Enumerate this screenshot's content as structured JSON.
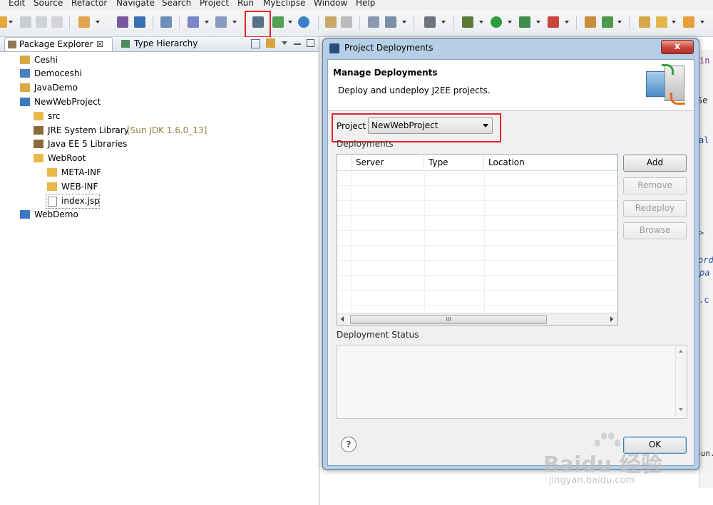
{
  "menu": [
    "Edit",
    "Source",
    "Refactor",
    "Navigate",
    "Search",
    "Project",
    "Run",
    "MyEclipse",
    "Window",
    "Help"
  ],
  "tabs": {
    "package_explorer": "Package Explorer",
    "package_explorer_close": "☒",
    "type_hierarchy": "Type Hierarchy"
  },
  "tree": [
    {
      "label": "Ceshi"
    },
    {
      "label": "Democeshi"
    },
    {
      "label": "JavaDemo"
    },
    {
      "label": "NewWebProject"
    },
    {
      "label": "src"
    },
    {
      "label": "JRE System Library",
      "decoration": "[Sun JDK 1.6.0_13]"
    },
    {
      "label": "Java EE 5 Libraries"
    },
    {
      "label": "WebRoot"
    },
    {
      "label": "META-INF"
    },
    {
      "label": "WEB-INF"
    },
    {
      "label": "index.jsp"
    },
    {
      "label": "WebDemo"
    }
  ],
  "editor_fragments": [
    "in",
    "Se",
    "al",
    ">",
    "ord",
    "pa",
    ".c",
    "sun."
  ],
  "dialog": {
    "title": "Project Deployments",
    "close_label": "x",
    "heading": "Manage Deployments",
    "description": "Deploy and undeploy J2EE projects.",
    "project_label": "Project",
    "project_value": "NewWebProject",
    "deployments_label": "Deployments",
    "columns": [
      "Server",
      "Type",
      "Location"
    ],
    "scroll_mark": "III",
    "buttons": {
      "add": "Add",
      "remove": "Remove",
      "redeploy": "Redeploy",
      "browse": "Browse",
      "ok": "OK"
    },
    "status_label": "Deployment Status",
    "help": "?"
  },
  "watermark": {
    "logo": "Baidu 经验",
    "url": "jingyan.baidu.com"
  },
  "colors": {
    "highlight": "#e8232a",
    "dialog_frame": "#b7cfe6",
    "folder": "#e8b84a",
    "project": "#4a7fc1"
  }
}
